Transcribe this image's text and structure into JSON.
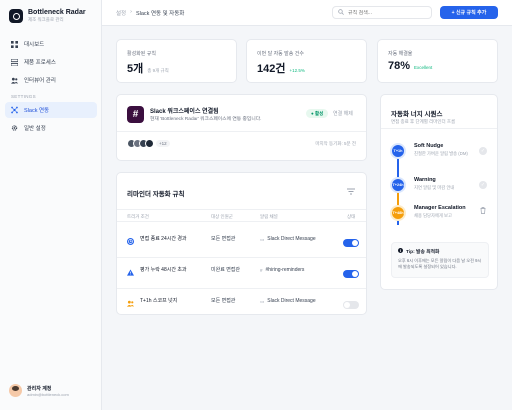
{
  "app": {
    "name": "Bottleneck Radar",
    "subtitle": "제조 워크플로 관리"
  },
  "sidebar": {
    "items": [
      {
        "label": "대시보드",
        "icon": "grid-icon"
      },
      {
        "label": "제품 프로세스",
        "icon": "layers-icon"
      },
      {
        "label": "인터뷰어 관리",
        "icon": "users-icon"
      }
    ],
    "section": "SETTINGS",
    "settings_items": [
      {
        "label": "Slack 연동",
        "icon": "network-icon",
        "active": true
      },
      {
        "label": "일반 설정",
        "icon": "gear-icon"
      }
    ]
  },
  "user": {
    "name": "관리자 계정",
    "email": "admin@bottleneck.com"
  },
  "topbar": {
    "breadcrumb": [
      "설정",
      "Slack 연동 및 자동화"
    ],
    "search_placeholder": "규칙 검색...",
    "add_button": "+ 신규 규칙 추가"
  },
  "stats": [
    {
      "label": "활성화된 규칙",
      "value": "5개",
      "sub": "총 9개 규칙",
      "sub_color": "muted"
    },
    {
      "label": "이번 달 자동 발송 건수",
      "value": "142건",
      "sub": "+12.5%",
      "sub_color": "green"
    },
    {
      "label": "자동 해결율",
      "value": "78%",
      "sub": "Excellent",
      "sub_color": "green"
    }
  ],
  "slack": {
    "title": "Slack 워크스페이스 연결됨",
    "description": "현재 'Bottleneck Radar' 워크스페이스에 연동 중입니다.",
    "status": "● 활성",
    "disconnect": "연결 해제",
    "extra_members": "+12",
    "last_sync": "마지막 동기화: 5분 전"
  },
  "rules": {
    "title": "리마인더 자동화 규칙",
    "columns": [
      "트리거 조건",
      "대상 인원군",
      "알림 채널",
      "상태"
    ],
    "rows": [
      {
        "icon": "clock-icon",
        "color": "#2563eb",
        "condition": "면접 종료 24시간 경과",
        "target": "모든 면접관",
        "channel": "Slack Direct Message",
        "enabled": true
      },
      {
        "icon": "warning-icon",
        "color": "#2563eb",
        "condition": "평가 누락 48시간 초과",
        "target": "미완료 면접관",
        "channel": "#hiring-reminders",
        "enabled": true
      },
      {
        "icon": "users-icon",
        "color": "#f59e0b",
        "condition": "T+1h 스코프 넛지",
        "target": "모든 면접관",
        "channel": "Slack Direct Message",
        "enabled": false
      }
    ]
  },
  "timeline": {
    "title": "자동화 너지 시퀀스",
    "subtitle": "면접 종료 후 단계별 리마인더 흐름",
    "steps": [
      {
        "tag": "T+1h",
        "name": "Soft Nudge",
        "desc": "친절한 가벼운 알림 발송 (DM)",
        "color": "#2563eb"
      },
      {
        "tag": "T+24h",
        "name": "Warning",
        "desc": "지연 알림 및 마감 안내",
        "color": "#2563eb"
      },
      {
        "tag": "T+48h",
        "name": "Manager Escalation",
        "desc": "채용 담당자에게 보고",
        "color": "#f59e0b"
      }
    ],
    "tip_title": "Tip: 발송 최적화",
    "tip_body": "오후 6시 이후에는 모든 알림이 다음 날 오전 9시에 발송되도록 설정되어 있습니다."
  }
}
